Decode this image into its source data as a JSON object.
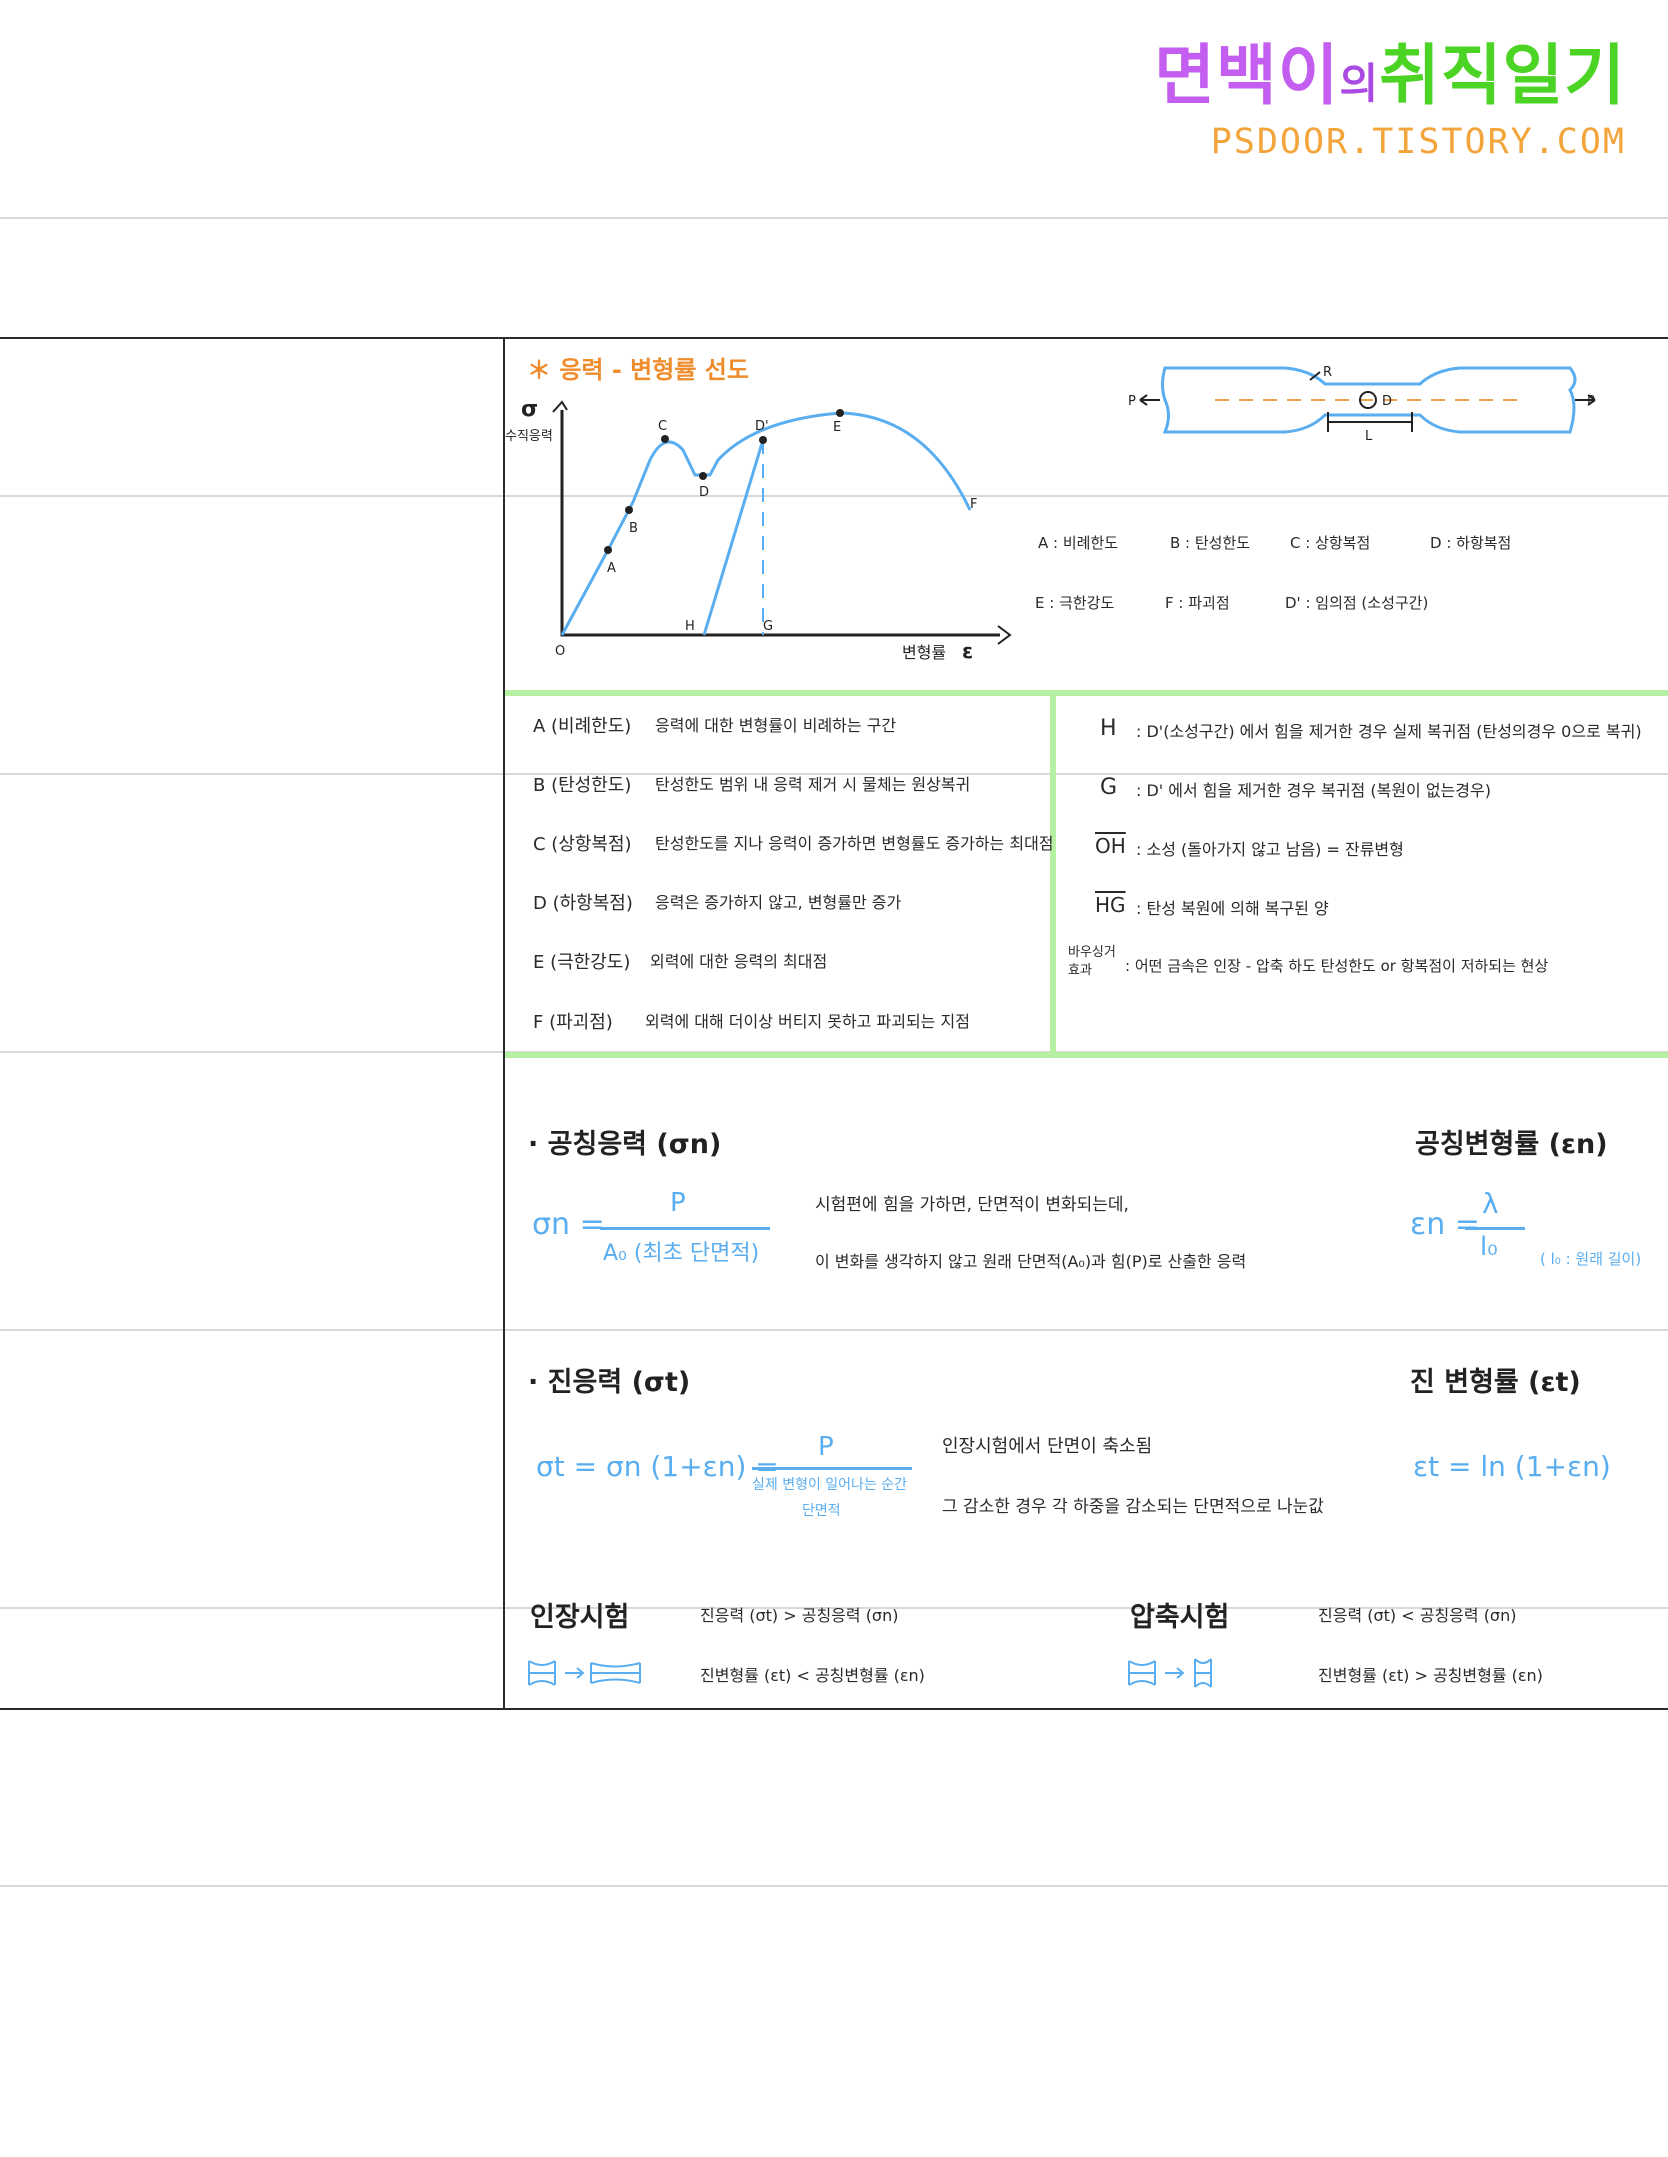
{
  "logo": {
    "part1": "면백이",
    "part2": "의",
    "part3": "취직일기",
    "url": "PSDOOR.TISTORY.COM"
  },
  "diagram": {
    "title": "＊ 응력 - 변형률 선도",
    "y_symbol": "σ",
    "y_label": "수직응력",
    "x_label": "변형률",
    "x_symbol": "ε",
    "points": {
      "O": "O",
      "A": "A",
      "B": "B",
      "C": "C",
      "D": "D",
      "Dp": "D'",
      "E": "E",
      "F": "F",
      "H": "H",
      "G": "G"
    },
    "specimen": {
      "P_left": "P",
      "P_right": "P",
      "R": "R",
      "D": "D",
      "L": "L"
    },
    "legend": [
      "A : 비례한도",
      "B : 탄성한도",
      "C : 상항복점",
      "D : 하항복점",
      "E : 극한강도",
      "F : 파괴점",
      "D' : 임의점 (소성구간)"
    ]
  },
  "definitions_left": [
    {
      "term": "A (비례한도)",
      "desc": "응력에 대한 변형률이 비례하는 구간"
    },
    {
      "term": "B (탄성한도)",
      "desc": "탄성한도 범위 내 응력 제거 시 물체는 원상복귀"
    },
    {
      "term": "C (상항복점)",
      "desc": "탄성한도를 지나 응력이 증가하면 변형률도 증가하는 최대점"
    },
    {
      "term": "D (하항복점)",
      "desc": "응력은 증가하지 않고, 변형률만 증가"
    },
    {
      "term": "E (극한강도)",
      "desc": "외력에 대한 응력의 최대점"
    },
    {
      "term": "F (파괴점)",
      "desc": "외력에 대해 더이상 버티지 못하고 파괴되는 지점"
    }
  ],
  "definitions_right": [
    {
      "term": "H",
      "desc": ": D'(소성구간) 에서 힘을 제거한 경우 실제 복귀점 (탄성의경우 0으로 복귀)"
    },
    {
      "term": "G",
      "desc": ": D' 에서 힘을 제거한 경우 복귀점 (복원이 없는경우)"
    },
    {
      "term": "OH",
      "desc": ": 소성 (돌아가지 않고 남음)    = 잔류변형"
    },
    {
      "term": "HG",
      "desc": ": 탄성 복원에 의해 복구된 양"
    },
    {
      "term": "바우싱거 효과",
      "desc": ": 어떤 금속은 인장 - 압축 하도 탄성한도 or 항복점이 저하되는 현상"
    }
  ],
  "nominal": {
    "stress_title": "· 공칭응력 (σn)",
    "strain_title": "공칭변형률 (εn)",
    "stress_lhs": "σn =",
    "stress_num": "P",
    "stress_den": "A₀ (최초 단면적)",
    "desc1": "시험편에 힘을 가하면, 단면적이 변화되는데,",
    "desc2": "이 변화를 생각하지 않고 원래 단면적(A₀)과 힘(P)로 산출한 응력",
    "strain_lhs": "εn =",
    "strain_num": "λ",
    "strain_den": "l₀",
    "strain_note": "( l₀ : 원래 길이)"
  },
  "true_stress": {
    "stress_title": "· 진응력 (σt)",
    "strain_title": "진 변형률 (εt)",
    "stress_formula": "σt = σn (1+εn) =",
    "stress_num": "P",
    "stress_den1": "실제 변형이 일어나는 순간",
    "stress_den2": "단면적",
    "desc1": "인장시험에서 단면이 축소됨",
    "desc2": "그 감소한 경우 각 하중을 감소되는 단면적으로 나눈값",
    "strain_formula": "εt = ln (1+εn)"
  },
  "tests": {
    "tension_title": "인장시험",
    "tension_line1": "진응력 (σt) > 공칭응력 (σn)",
    "tension_line2": "진변형률 (εt) < 공칭변형률 (εn)",
    "compression_title": "압축시험",
    "compression_line1": "진응력 (σt) < 공칭응력 (σn)",
    "compression_line2": "진변형률 (εt) > 공칭변형률 (εn)"
  }
}
